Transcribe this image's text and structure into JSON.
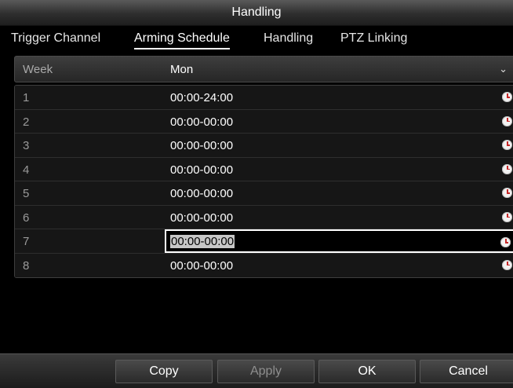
{
  "window": {
    "title": "Handling"
  },
  "tabs": [
    {
      "label": "Trigger Channel",
      "active": false
    },
    {
      "label": "Arming Schedule",
      "active": true
    },
    {
      "label": "Handling",
      "active": false
    },
    {
      "label": "PTZ Linking",
      "active": false
    }
  ],
  "week": {
    "label": "Week",
    "value": "Mon"
  },
  "schedule": [
    {
      "index": "1",
      "time": "00:00-24:00",
      "icon": "clock-icon"
    },
    {
      "index": "2",
      "time": "00:00-00:00",
      "icon": "clock-icon"
    },
    {
      "index": "3",
      "time": "00:00-00:00",
      "icon": "clock-icon"
    },
    {
      "index": "4",
      "time": "00:00-00:00",
      "icon": "clock-icon"
    },
    {
      "index": "5",
      "time": "00:00-00:00",
      "icon": "clock-icon"
    },
    {
      "index": "6",
      "time": "00:00-00:00",
      "icon": "clock-icon"
    },
    {
      "index": "7",
      "time": "00:00-00:00",
      "icon": "clock-icon",
      "selected": true
    },
    {
      "index": "8",
      "time": "00:00-00:00",
      "icon": "clock-icon"
    }
  ],
  "buttons": {
    "copy": "Copy",
    "apply": "Apply",
    "ok": "OK",
    "cancel": "Cancel"
  }
}
